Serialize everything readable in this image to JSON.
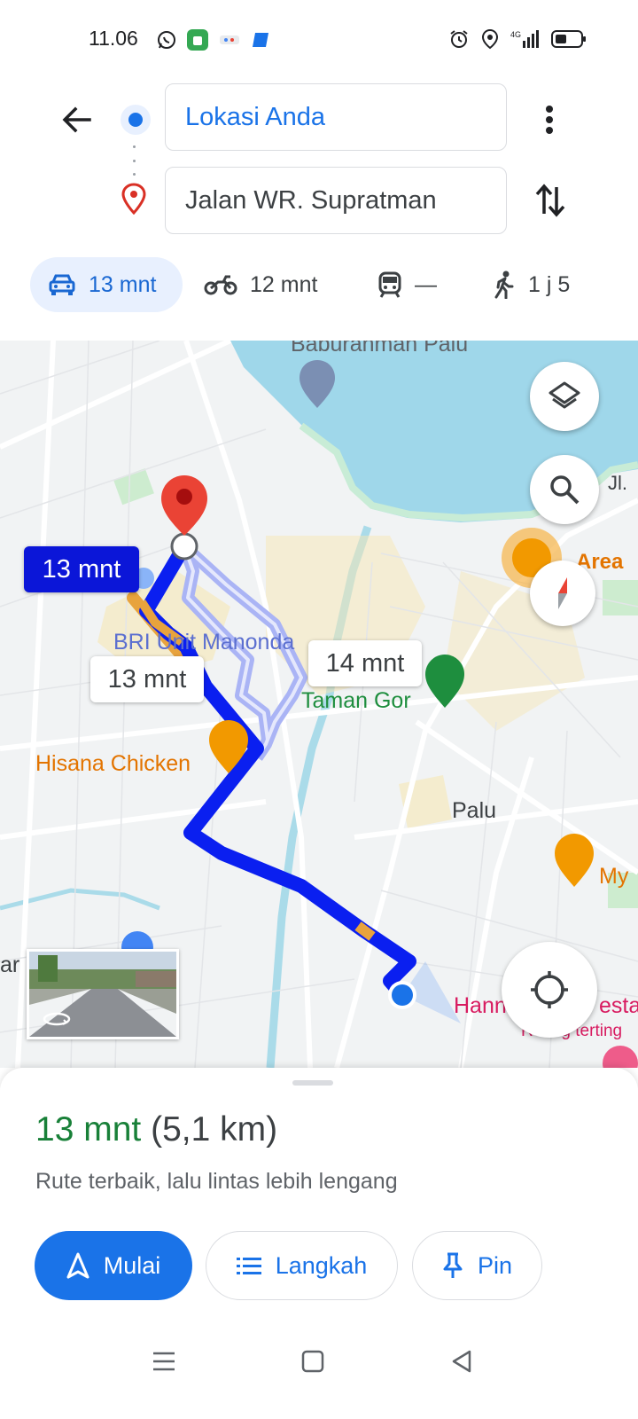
{
  "status_bar": {
    "time": "11.06",
    "network": "4G"
  },
  "directions": {
    "origin_value": "Lokasi Anda",
    "destination_value": "Jalan WR. Supratman"
  },
  "modes": [
    {
      "label": "13 mnt",
      "icon": "car-icon",
      "selected": true
    },
    {
      "label": "12 mnt",
      "icon": "motorcycle-icon",
      "selected": false
    },
    {
      "label": "—",
      "icon": "train-icon",
      "selected": false
    },
    {
      "label": "1 j 5",
      "icon": "walk-icon",
      "selected": false
    }
  ],
  "map": {
    "labels": {
      "top_poi": "Baburahman Palu",
      "bank": "BRI Unit Manonda",
      "restaurant": "Hisana Chicken",
      "park": "Taman Gor",
      "city": "Palu",
      "area": "Area",
      "right_poi": "My",
      "bottom_poi": "Hann",
      "bottom_poi_suffix": "esta",
      "bottom_poi_sub": "Ruang terting",
      "left_cut": "ar",
      "top_right_cut": "Jl."
    },
    "route_chips": {
      "primary": "13 mnt",
      "alt1": "13 mnt",
      "alt2": "14 mnt"
    },
    "colors": {
      "route_primary": "#0a1ff0",
      "route_alt": "#aab4f5",
      "water": "#9fd7ea",
      "traffic": "#e8a33d"
    }
  },
  "sheet": {
    "duration": "13 mnt",
    "distance": "(5,1 km)",
    "subtitle": "Rute terbaik, lalu lintas lebih lengang",
    "buttons": {
      "start": "Mulai",
      "steps": "Langkah",
      "pin": "Pin"
    }
  }
}
